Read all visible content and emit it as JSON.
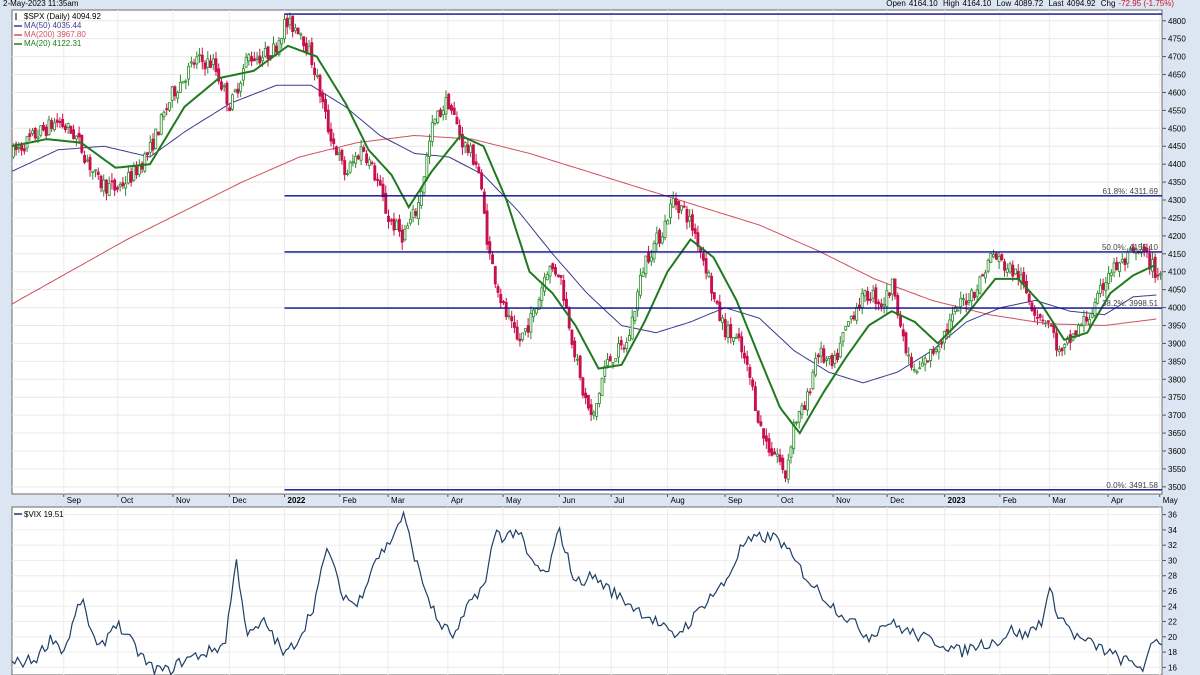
{
  "header": {
    "date": "2-May-2023 11:35am",
    "open_label": "Open",
    "open": "4164.10",
    "high_label": "High",
    "high": "4164.10",
    "low_label": "Low",
    "low": "4089.72",
    "last_label": "Last",
    "last": "4094.92",
    "chg_label": "Chg",
    "chg": "-72.95 (-1.75%)"
  },
  "colors": {
    "background": "#dce6f2",
    "panel": "#ffffff",
    "up_candle": "#2a8a2a",
    "down_candle": "#c8104e",
    "ma50": "#3c3c8c",
    "ma200": "#d05060",
    "ma20": "#1f7a1f",
    "fib_line": "#0a0a8c",
    "vix_line": "#1f3f66"
  },
  "legend": [
    {
      "text": "$SPX (Daily) 4094.92",
      "color": "#000000",
      "marker": "spx"
    },
    {
      "text": "MA(50) 4035.44",
      "color": "#3c3c8c",
      "marker": "ma50"
    },
    {
      "text": "MA(200) 3967.80",
      "color": "#d05060",
      "marker": "ma200"
    },
    {
      "text": "MA(20) 4122.31",
      "color": "#1f7a1f",
      "marker": "ma20"
    }
  ],
  "vix_label": "$VIX 19.51",
  "chart_data": [
    {
      "type": "line",
      "x_axis": {
        "months": [
          {
            "label": "Sep",
            "t": 0.045,
            "bold": false
          },
          {
            "label": "Oct",
            "t": 0.092,
            "bold": false
          },
          {
            "label": "Nov",
            "t": 0.14,
            "bold": false
          },
          {
            "label": "Dec",
            "t": 0.189,
            "bold": false
          },
          {
            "label": "2022",
            "t": 0.237,
            "bold": true
          },
          {
            "label": "Feb",
            "t": 0.285,
            "bold": false
          },
          {
            "label": "Mar",
            "t": 0.327,
            "bold": false
          },
          {
            "label": "Apr",
            "t": 0.379,
            "bold": false
          },
          {
            "label": "May",
            "t": 0.427,
            "bold": false
          },
          {
            "label": "Jun",
            "t": 0.476,
            "bold": false
          },
          {
            "label": "Jul",
            "t": 0.521,
            "bold": false
          },
          {
            "label": "Aug",
            "t": 0.57,
            "bold": false
          },
          {
            "label": "Sep",
            "t": 0.62,
            "bold": false
          },
          {
            "label": "Oct",
            "t": 0.666,
            "bold": false
          },
          {
            "label": "Nov",
            "t": 0.714,
            "bold": false
          },
          {
            "label": "Dec",
            "t": 0.761,
            "bold": false
          },
          {
            "label": "2023",
            "t": 0.811,
            "bold": true
          },
          {
            "label": "Feb",
            "t": 0.859,
            "bold": false
          },
          {
            "label": "Mar",
            "t": 0.902,
            "bold": false
          },
          {
            "label": "Apr",
            "t": 0.953,
            "bold": false
          },
          {
            "label": "May",
            "t": 0.998,
            "bold": false
          }
        ]
      },
      "y_ticks": [
        3500,
        3550,
        3600,
        3650,
        3700,
        3750,
        3800,
        3850,
        3900,
        3950,
        4000,
        4050,
        4100,
        4150,
        4200,
        4250,
        4300,
        4350,
        4400,
        4450,
        4500,
        4550,
        4600,
        4650,
        4700,
        4750,
        4800
      ],
      "ylim": [
        3480,
        4830
      ],
      "fib_levels": [
        {
          "label": "61.8%: 4311.69",
          "value": 4311.69
        },
        {
          "label": "50.0%: 4155.10",
          "value": 4155.1
        },
        {
          "label": "38.2%: 3998.51",
          "value": 3998.51
        },
        {
          "label": "0.0%: 3491.58",
          "value": 3491.58
        },
        {
          "label": "",
          "value": 4818.62
        }
      ],
      "fib_start_t": 0.237,
      "spx_anchors": [
        [
          0.0,
          4430
        ],
        [
          0.02,
          4480
        ],
        [
          0.04,
          4520
        ],
        [
          0.055,
          4480
        ],
        [
          0.075,
          4350
        ],
        [
          0.09,
          4330
        ],
        [
          0.105,
          4370
        ],
        [
          0.12,
          4440
        ],
        [
          0.14,
          4600
        ],
        [
          0.16,
          4690
        ],
        [
          0.175,
          4680
        ],
        [
          0.19,
          4560
        ],
        [
          0.205,
          4700
        ],
        [
          0.218,
          4700
        ],
        [
          0.228,
          4720
        ],
        [
          0.237,
          4790
        ],
        [
          0.25,
          4780
        ],
        [
          0.262,
          4680
        ],
        [
          0.275,
          4500
        ],
        [
          0.29,
          4370
        ],
        [
          0.305,
          4450
        ],
        [
          0.318,
          4350
        ],
        [
          0.327,
          4250
        ],
        [
          0.34,
          4200
        ],
        [
          0.353,
          4280
        ],
        [
          0.366,
          4510
        ],
        [
          0.379,
          4580
        ],
        [
          0.392,
          4460
        ],
        [
          0.405,
          4400
        ],
        [
          0.415,
          4150
        ],
        [
          0.427,
          4000
        ],
        [
          0.44,
          3900
        ],
        [
          0.455,
          3990
        ],
        [
          0.465,
          4110
        ],
        [
          0.476,
          4100
        ],
        [
          0.488,
          3900
        ],
        [
          0.495,
          3780
        ],
        [
          0.505,
          3680
        ],
        [
          0.515,
          3830
        ],
        [
          0.521,
          3860
        ],
        [
          0.535,
          3900
        ],
        [
          0.55,
          4130
        ],
        [
          0.565,
          4210
        ],
        [
          0.575,
          4300
        ],
        [
          0.585,
          4270
        ],
        [
          0.595,
          4200
        ],
        [
          0.605,
          4100
        ],
        [
          0.612,
          4000
        ],
        [
          0.62,
          3940
        ],
        [
          0.632,
          3900
        ],
        [
          0.642,
          3800
        ],
        [
          0.652,
          3650
        ],
        [
          0.66,
          3600
        ],
        [
          0.666,
          3590
        ],
        [
          0.672,
          3520
        ],
        [
          0.68,
          3680
        ],
        [
          0.69,
          3720
        ],
        [
          0.7,
          3880
        ],
        [
          0.714,
          3830
        ],
        [
          0.725,
          3940
        ],
        [
          0.735,
          4010
        ],
        [
          0.747,
          4040
        ],
        [
          0.757,
          4010
        ],
        [
          0.767,
          4070
        ],
        [
          0.775,
          3900
        ],
        [
          0.785,
          3810
        ],
        [
          0.797,
          3860
        ],
        [
          0.811,
          3930
        ],
        [
          0.825,
          4010
        ],
        [
          0.84,
          4060
        ],
        [
          0.852,
          4150
        ],
        [
          0.862,
          4120
        ],
        [
          0.875,
          4090
        ],
        [
          0.89,
          3990
        ],
        [
          0.902,
          3960
        ],
        [
          0.912,
          3860
        ],
        [
          0.92,
          3910
        ],
        [
          0.932,
          3960
        ],
        [
          0.942,
          4000
        ],
        [
          0.953,
          4100
        ],
        [
          0.965,
          4120
        ],
        [
          0.975,
          4150
        ],
        [
          0.985,
          4150
        ],
        [
          0.995,
          4095
        ]
      ],
      "ma20_anchors": [
        [
          0.0,
          4450
        ],
        [
          0.03,
          4470
        ],
        [
          0.06,
          4460
        ],
        [
          0.09,
          4390
        ],
        [
          0.12,
          4400
        ],
        [
          0.15,
          4560
        ],
        [
          0.18,
          4640
        ],
        [
          0.21,
          4660
        ],
        [
          0.24,
          4730
        ],
        [
          0.265,
          4700
        ],
        [
          0.29,
          4570
        ],
        [
          0.31,
          4440
        ],
        [
          0.33,
          4370
        ],
        [
          0.345,
          4280
        ],
        [
          0.365,
          4380
        ],
        [
          0.39,
          4480
        ],
        [
          0.41,
          4450
        ],
        [
          0.43,
          4300
        ],
        [
          0.45,
          4100
        ],
        [
          0.47,
          4040
        ],
        [
          0.49,
          3950
        ],
        [
          0.51,
          3830
        ],
        [
          0.53,
          3840
        ],
        [
          0.55,
          3960
        ],
        [
          0.57,
          4100
        ],
        [
          0.59,
          4190
        ],
        [
          0.61,
          4140
        ],
        [
          0.63,
          4020
        ],
        [
          0.65,
          3860
        ],
        [
          0.668,
          3720
        ],
        [
          0.685,
          3650
        ],
        [
          0.705,
          3760
        ],
        [
          0.725,
          3860
        ],
        [
          0.745,
          3950
        ],
        [
          0.765,
          3990
        ],
        [
          0.785,
          3960
        ],
        [
          0.805,
          3900
        ],
        [
          0.83,
          3980
        ],
        [
          0.855,
          4080
        ],
        [
          0.875,
          4080
        ],
        [
          0.895,
          4010
        ],
        [
          0.915,
          3910
        ],
        [
          0.935,
          3930
        ],
        [
          0.955,
          4040
        ],
        [
          0.975,
          4090
        ],
        [
          0.995,
          4120
        ]
      ],
      "ma50_anchors": [
        [
          0.0,
          4380
        ],
        [
          0.04,
          4440
        ],
        [
          0.08,
          4450
        ],
        [
          0.12,
          4420
        ],
        [
          0.15,
          4490
        ],
        [
          0.19,
          4570
        ],
        [
          0.23,
          4620
        ],
        [
          0.26,
          4620
        ],
        [
          0.29,
          4560
        ],
        [
          0.32,
          4480
        ],
        [
          0.35,
          4430
        ],
        [
          0.38,
          4420
        ],
        [
          0.41,
          4370
        ],
        [
          0.44,
          4270
        ],
        [
          0.47,
          4150
        ],
        [
          0.5,
          4040
        ],
        [
          0.53,
          3950
        ],
        [
          0.56,
          3930
        ],
        [
          0.59,
          3960
        ],
        [
          0.62,
          4000
        ],
        [
          0.65,
          3970
        ],
        [
          0.68,
          3880
        ],
        [
          0.71,
          3820
        ],
        [
          0.74,
          3790
        ],
        [
          0.77,
          3820
        ],
        [
          0.8,
          3880
        ],
        [
          0.83,
          3960
        ],
        [
          0.86,
          4000
        ],
        [
          0.89,
          4020
        ],
        [
          0.92,
          3990
        ],
        [
          0.95,
          3980
        ],
        [
          0.975,
          4030
        ],
        [
          0.995,
          4035
        ]
      ],
      "ma200_anchors": [
        [
          0.0,
          4010
        ],
        [
          0.05,
          4100
        ],
        [
          0.1,
          4190
        ],
        [
          0.15,
          4270
        ],
        [
          0.2,
          4350
        ],
        [
          0.25,
          4420
        ],
        [
          0.3,
          4460
        ],
        [
          0.35,
          4480
        ],
        [
          0.4,
          4470
        ],
        [
          0.45,
          4430
        ],
        [
          0.5,
          4380
        ],
        [
          0.55,
          4330
        ],
        [
          0.6,
          4280
        ],
        [
          0.65,
          4230
        ],
        [
          0.7,
          4160
        ],
        [
          0.75,
          4080
        ],
        [
          0.8,
          4020
        ],
        [
          0.85,
          3980
        ],
        [
          0.9,
          3955
        ],
        [
          0.95,
          3950
        ],
        [
          0.995,
          3968
        ]
      ]
    },
    {
      "type": "line",
      "y_ticks": [
        16,
        18,
        20,
        22,
        24,
        26,
        28,
        30,
        32,
        34,
        36
      ],
      "ylim": [
        15,
        37
      ],
      "vix_anchors": [
        [
          0.0,
          16.5
        ],
        [
          0.02,
          17
        ],
        [
          0.035,
          20
        ],
        [
          0.045,
          18
        ],
        [
          0.06,
          25
        ],
        [
          0.075,
          18
        ],
        [
          0.09,
          22
        ],
        [
          0.105,
          19
        ],
        [
          0.12,
          16
        ],
        [
          0.135,
          15.5
        ],
        [
          0.15,
          17
        ],
        [
          0.17,
          18
        ],
        [
          0.185,
          19
        ],
        [
          0.195,
          30
        ],
        [
          0.205,
          20
        ],
        [
          0.22,
          22
        ],
        [
          0.237,
          17.5
        ],
        [
          0.25,
          20
        ],
        [
          0.262,
          24
        ],
        [
          0.275,
          32
        ],
        [
          0.285,
          26
        ],
        [
          0.3,
          24
        ],
        [
          0.315,
          30
        ],
        [
          0.327,
          32
        ],
        [
          0.34,
          36
        ],
        [
          0.355,
          28
        ],
        [
          0.37,
          22
        ],
        [
          0.385,
          20
        ],
        [
          0.4,
          25
        ],
        [
          0.412,
          27
        ],
        [
          0.42,
          34
        ],
        [
          0.427,
          33
        ],
        [
          0.44,
          34
        ],
        [
          0.45,
          30
        ],
        [
          0.465,
          28
        ],
        [
          0.476,
          34
        ],
        [
          0.49,
          27
        ],
        [
          0.505,
          28
        ],
        [
          0.521,
          26
        ],
        [
          0.54,
          24
        ],
        [
          0.56,
          22
        ],
        [
          0.575,
          20
        ],
        [
          0.59,
          22
        ],
        [
          0.605,
          25
        ],
        [
          0.62,
          27
        ],
        [
          0.635,
          32
        ],
        [
          0.65,
          33
        ],
        [
          0.666,
          33
        ],
        [
          0.68,
          30
        ],
        [
          0.695,
          27
        ],
        [
          0.714,
          24
        ],
        [
          0.73,
          22
        ],
        [
          0.745,
          20
        ],
        [
          0.761,
          22
        ],
        [
          0.775,
          21
        ],
        [
          0.79,
          20
        ],
        [
          0.811,
          19
        ],
        [
          0.825,
          18
        ],
        [
          0.84,
          19
        ],
        [
          0.859,
          19.5
        ],
        [
          0.87,
          21
        ],
        [
          0.88,
          20
        ],
        [
          0.895,
          22
        ],
        [
          0.902,
          26
        ],
        [
          0.91,
          23
        ],
        [
          0.925,
          20
        ],
        [
          0.94,
          19
        ],
        [
          0.953,
          18
        ],
        [
          0.965,
          17
        ],
        [
          0.975,
          16.5
        ],
        [
          0.985,
          16
        ],
        [
          0.993,
          19.5
        ]
      ]
    }
  ]
}
